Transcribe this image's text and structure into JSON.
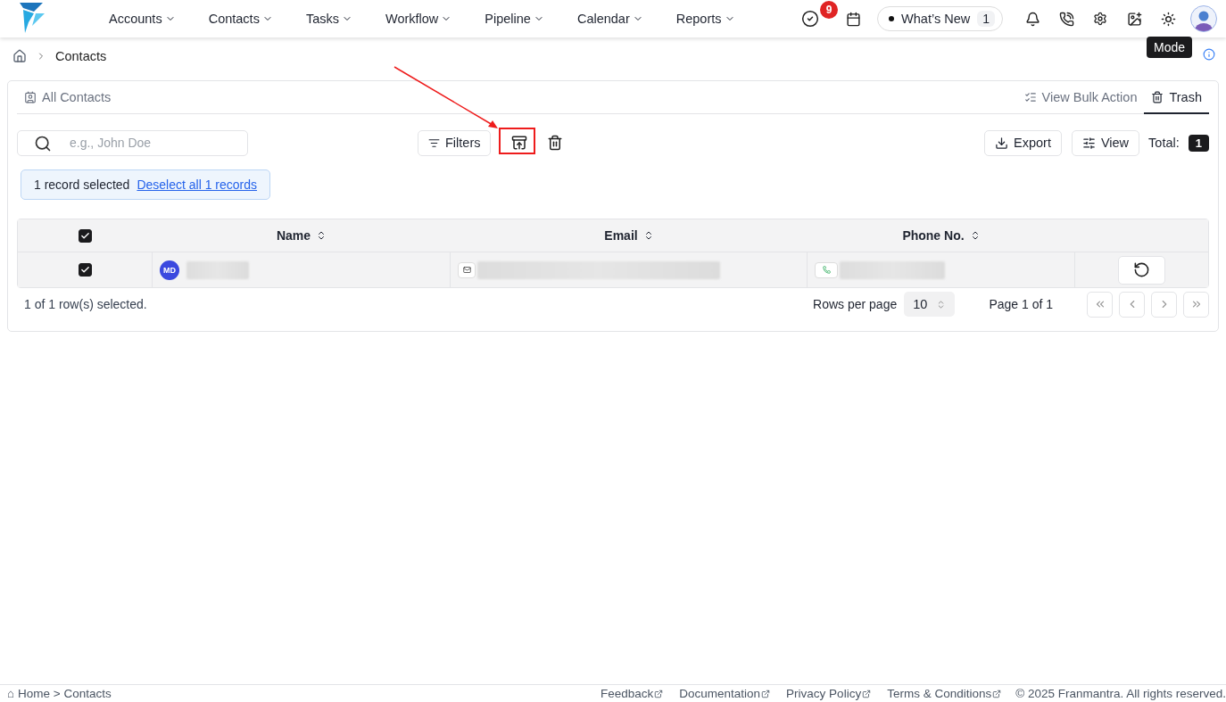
{
  "nav": {
    "items": [
      {
        "label": "Accounts"
      },
      {
        "label": "Contacts"
      },
      {
        "label": "Tasks"
      },
      {
        "label": "Workflow"
      },
      {
        "label": "Pipeline"
      },
      {
        "label": "Calendar"
      },
      {
        "label": "Reports"
      }
    ]
  },
  "header_actions": {
    "tasks_badge": "9",
    "whats_new": {
      "label": "What’s New",
      "count": "1"
    },
    "tooltip": "Mode"
  },
  "breadcrumb": [
    "Contacts"
  ],
  "tabs": [
    {
      "label": "All Contacts",
      "selected": false
    },
    {
      "label": "View Bulk Action",
      "selected": false
    },
    {
      "label": "Trash",
      "selected": true
    }
  ],
  "search": {
    "placeholder": "e.g., John Doe"
  },
  "toolbar": {
    "filters": "Filters",
    "export": "Export",
    "view": "View",
    "total_label": "Total:",
    "total": "1"
  },
  "selection": {
    "text": "1 record selected",
    "link": "Deselect all 1 records"
  },
  "table": {
    "header_checked": true,
    "columns": [
      "Name",
      "Email",
      "Phone No."
    ],
    "rows": [
      {
        "checked": true,
        "initials": "MD"
      }
    ]
  },
  "pagination": {
    "summary": "1 of 1 row(s) selected.",
    "rows_per_page_label": "Rows per page",
    "rows_per_page": "10",
    "page": "Page 1 of 1"
  },
  "footer": {
    "breadcrumb": [
      "⌂ Home >",
      "Contacts"
    ],
    "links": [
      "Feedback",
      "Documentation",
      "Privacy Policy",
      "Terms & Conditions"
    ],
    "copyright": "© 2025 Franmantra. All rights reserved."
  }
}
